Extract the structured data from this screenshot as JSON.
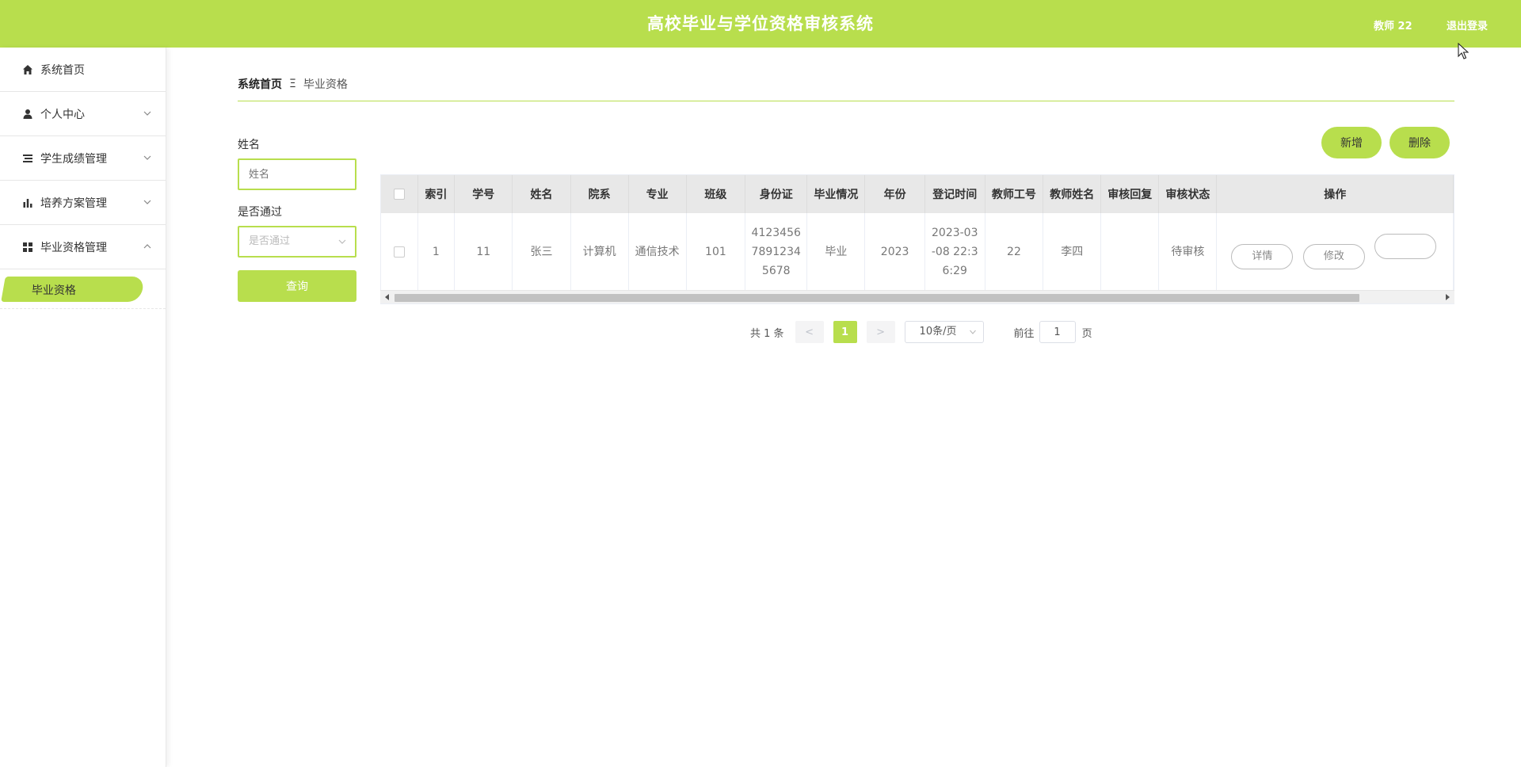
{
  "app": {
    "title": "高校毕业与学位资格审核系统",
    "user": "教师 22",
    "logout": "退出登录",
    "accent": "#b8de4d"
  },
  "sidebar": {
    "items": [
      {
        "label": "系统首页",
        "icon": "home-icon"
      },
      {
        "label": "个人中心",
        "icon": "user-icon"
      },
      {
        "label": "学生成绩管理",
        "icon": "list-icon"
      },
      {
        "label": "培养方案管理",
        "icon": "bar-chart-icon"
      },
      {
        "label": "毕业资格管理",
        "icon": "grid-icon"
      }
    ],
    "sub_item": "毕业资格"
  },
  "breadcrumb": {
    "home": "系统首页",
    "separator": "Ξ",
    "current": "毕业资格"
  },
  "filters": {
    "name_label": "姓名",
    "name_placeholder": "姓名",
    "pass_label": "是否通过",
    "pass_placeholder": "是否通过",
    "search_button": "查询"
  },
  "actions": {
    "add": "新增",
    "delete": "删除"
  },
  "table": {
    "headers": [
      "索引",
      "学号",
      "姓名",
      "院系",
      "专业",
      "班级",
      "身份证",
      "毕业情况",
      "年份",
      "登记时间",
      "教师工号",
      "教师姓名",
      "审核回复",
      "审核状态",
      "操作"
    ],
    "rows": [
      {
        "index": "1",
        "student_id": "11",
        "name": "张三",
        "department": "计算机",
        "major": "通信技术",
        "class": "101",
        "id_card_1": "4123456",
        "id_card_2": "7891234",
        "id_card_3": "5678",
        "graduation": "毕业",
        "year": "2023",
        "time_1": "2023-03",
        "time_2": "-08 22:3",
        "time_3": "6:29",
        "teacher_id": "22",
        "teacher_name": "李四",
        "reply": "",
        "status": "待审核",
        "op_detail": "详情",
        "op_edit": "修改"
      }
    ]
  },
  "pagination": {
    "total": "共 1 条",
    "prev": "<",
    "current": "1",
    "next": ">",
    "page_size": "10条/页",
    "goto_label": "前往",
    "goto_value": "1",
    "goto_suffix": "页"
  }
}
